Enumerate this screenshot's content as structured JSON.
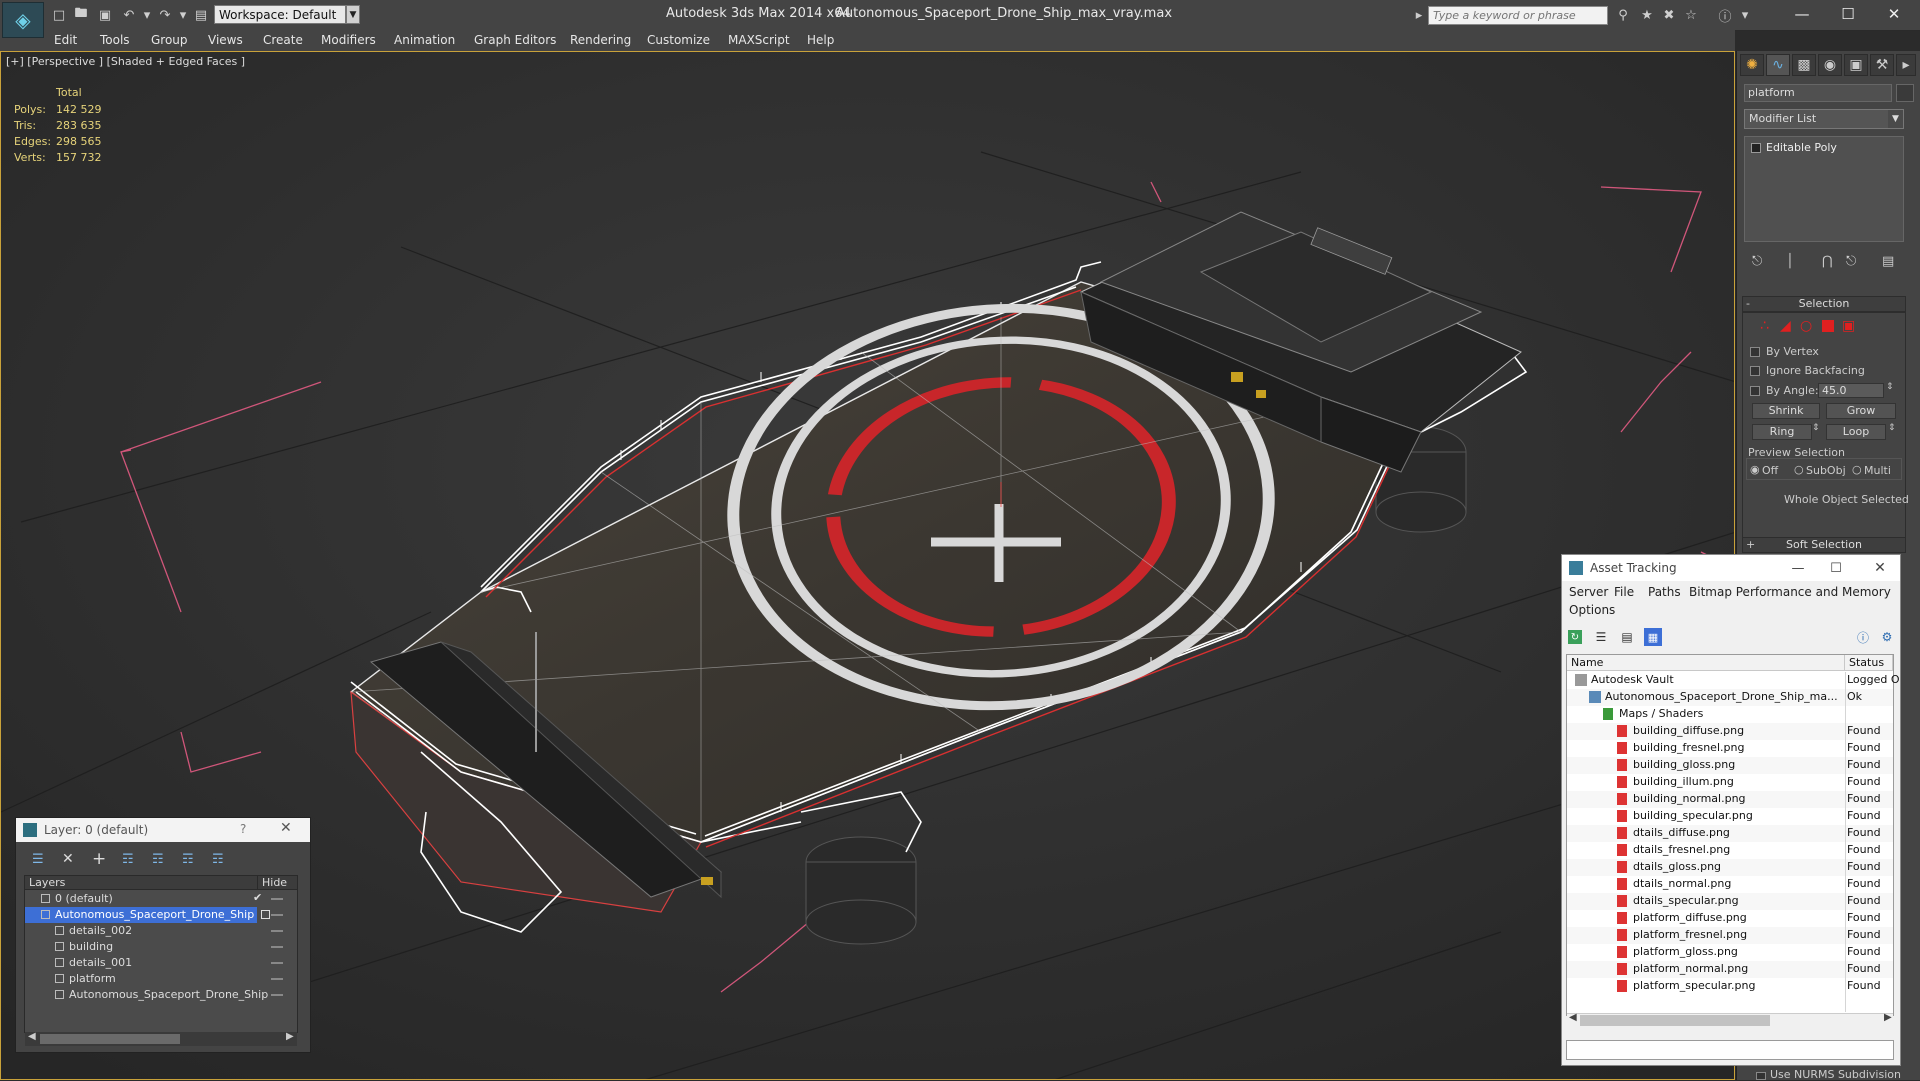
{
  "titlebar": {
    "app_title": "Autodesk 3ds Max  2014 x64",
    "document_title": "Autonomous_Spaceport_Drone_Ship_max_vray.max",
    "workspace": "Workspace: Default",
    "search_placeholder": "Type a keyword or phrase"
  },
  "menu": [
    "Edit",
    "Tools",
    "Group",
    "Views",
    "Create",
    "Modifiers",
    "Animation",
    "Graph Editors",
    "Rendering",
    "Customize",
    "MAXScript",
    "Help"
  ],
  "viewport": {
    "label": "[+] [Perspective ] [Shaded + Edged Faces ]",
    "stats": {
      "header": "Total",
      "rows": [
        {
          "label": "Polys:",
          "value": "142 529"
        },
        {
          "label": "Tris:",
          "value": "283 635"
        },
        {
          "label": "Edges:",
          "value": "298 565"
        },
        {
          "label": "Verts:",
          "value": "157 732"
        }
      ]
    }
  },
  "command_panel": {
    "object_name": "platform",
    "modifier_list": "Modifier List",
    "stack_item": "Editable Poly",
    "selection_rollout": "Selection",
    "by_vertex": "By Vertex",
    "ignore_backfacing": "Ignore Backfacing",
    "by_angle": "By Angle:",
    "angle_value": "45.0",
    "shrink": "Shrink",
    "grow": "Grow",
    "ring": "Ring",
    "loop": "Loop",
    "preview_selection": "Preview Selection",
    "preview_off": "Off",
    "preview_subobj": "SubObj",
    "preview_multi": "Multi",
    "status": "Whole Object Selected",
    "soft_selection": "Soft Selection",
    "nurms": "Use NURMS Subdivision"
  },
  "asset_tracking": {
    "title": "Asset Tracking",
    "menu": [
      "Server",
      "File",
      "Paths",
      "Bitmap Performance and Memory"
    ],
    "menu2": "Options",
    "columns": {
      "name": "Name",
      "status": "Status"
    },
    "rows": [
      {
        "name": "Autodesk Vault",
        "status": "Logged O",
        "indent": 0,
        "icon": "vault"
      },
      {
        "name": "Autonomous_Spaceport_Drone_Ship_ma...",
        "status": "Ok",
        "indent": 1,
        "icon": "max"
      },
      {
        "name": "Maps / Shaders",
        "status": "",
        "indent": 2,
        "icon": "folder"
      },
      {
        "name": "building_diffuse.png",
        "status": "Found",
        "indent": 3,
        "icon": "png"
      },
      {
        "name": "building_fresnel.png",
        "status": "Found",
        "indent": 3,
        "icon": "png"
      },
      {
        "name": "building_gloss.png",
        "status": "Found",
        "indent": 3,
        "icon": "png"
      },
      {
        "name": "building_illum.png",
        "status": "Found",
        "indent": 3,
        "icon": "png"
      },
      {
        "name": "building_normal.png",
        "status": "Found",
        "indent": 3,
        "icon": "png"
      },
      {
        "name": "building_specular.png",
        "status": "Found",
        "indent": 3,
        "icon": "png"
      },
      {
        "name": "dtails_diffuse.png",
        "status": "Found",
        "indent": 3,
        "icon": "png"
      },
      {
        "name": "dtails_fresnel.png",
        "status": "Found",
        "indent": 3,
        "icon": "png"
      },
      {
        "name": "dtails_gloss.png",
        "status": "Found",
        "indent": 3,
        "icon": "png"
      },
      {
        "name": "dtails_normal.png",
        "status": "Found",
        "indent": 3,
        "icon": "png"
      },
      {
        "name": "dtails_specular.png",
        "status": "Found",
        "indent": 3,
        "icon": "png"
      },
      {
        "name": "platform_diffuse.png",
        "status": "Found",
        "indent": 3,
        "icon": "png"
      },
      {
        "name": "platform_fresnel.png",
        "status": "Found",
        "indent": 3,
        "icon": "png"
      },
      {
        "name": "platform_gloss.png",
        "status": "Found",
        "indent": 3,
        "icon": "png"
      },
      {
        "name": "platform_normal.png",
        "status": "Found",
        "indent": 3,
        "icon": "png"
      },
      {
        "name": "platform_specular.png",
        "status": "Found",
        "indent": 3,
        "icon": "png"
      }
    ]
  },
  "layer_window": {
    "title": "Layer: 0 (default)",
    "help": "?",
    "columns": {
      "layers": "Layers",
      "hide": "Hide"
    },
    "rows": [
      {
        "name": "0 (default)",
        "indent": 1,
        "selected": false
      },
      {
        "name": "Autonomous_Spaceport_Drone_Ship",
        "indent": 1,
        "selected": true
      },
      {
        "name": "details_002",
        "indent": 2,
        "selected": false
      },
      {
        "name": "building",
        "indent": 2,
        "selected": false
      },
      {
        "name": "details_001",
        "indent": 2,
        "selected": false
      },
      {
        "name": "platform",
        "indent": 2,
        "selected": false
      },
      {
        "name": "Autonomous_Spaceport_Drone_Ship",
        "indent": 2,
        "selected": false
      }
    ]
  },
  "colors": {
    "accent_blue": "#3d6fd6",
    "stat_yellow": "#e6d37a",
    "selection_red": "#e02020",
    "wire_white": "#ffffff",
    "pad_red": "#c8262a"
  }
}
